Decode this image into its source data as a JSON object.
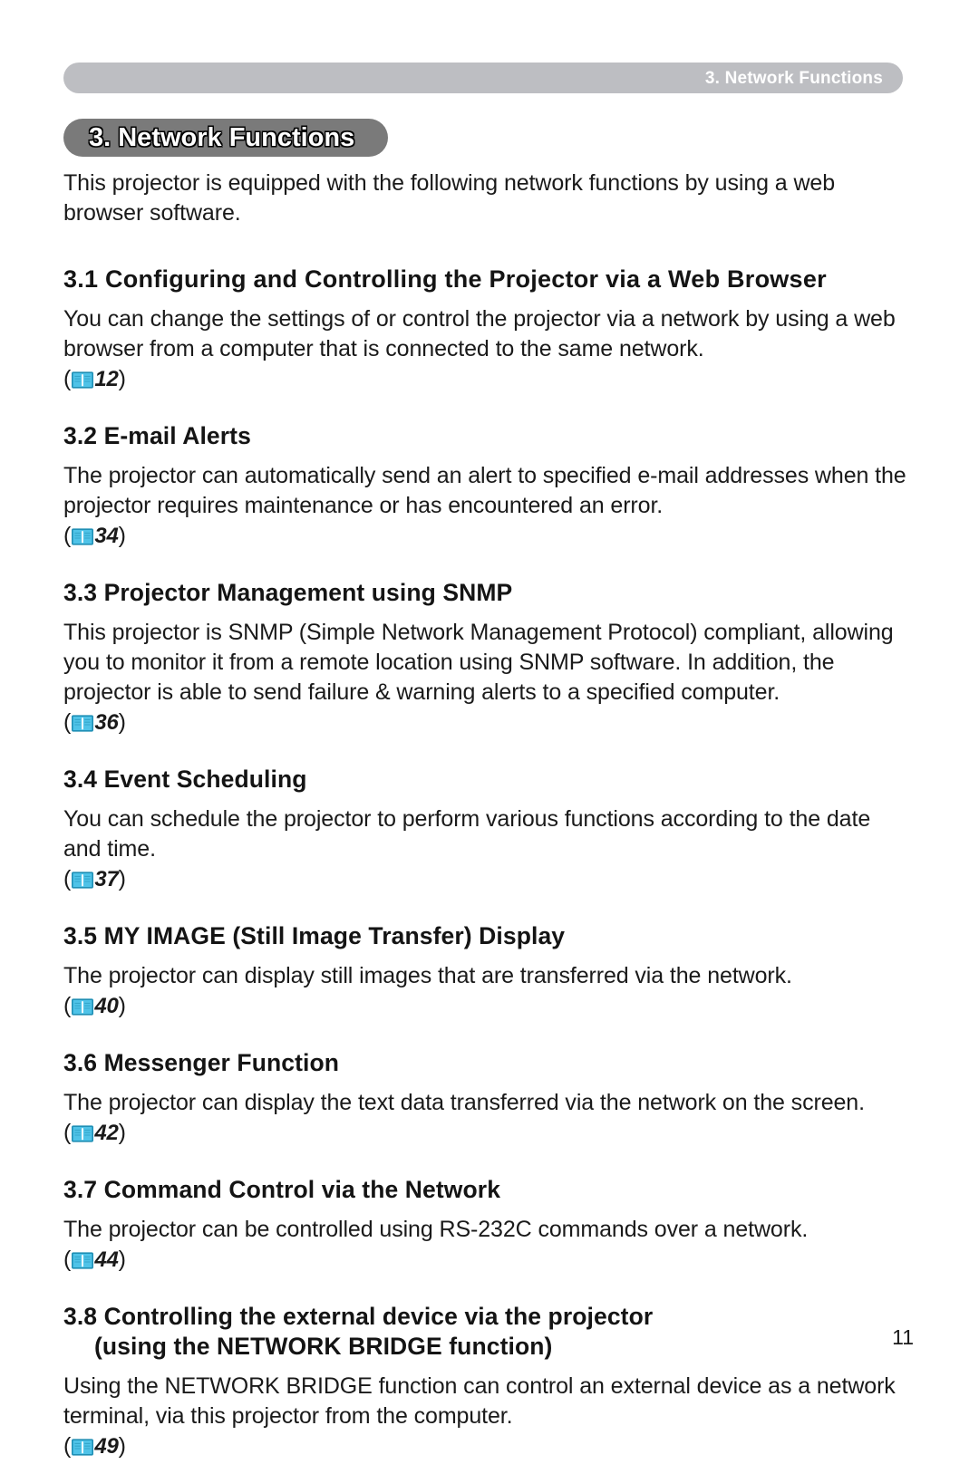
{
  "document": {
    "running_header": "3. Network Functions",
    "chapter_title": "3. Network Functions",
    "page_number": "11",
    "icon_colors": {
      "book_icon_outline": "#1f8fb5",
      "book_icon_fill": "#4fc3e8",
      "header_bar": "#bdbec2",
      "title_pill": "#7a7a7a"
    }
  },
  "intro": {
    "text": "This projector is equipped with the following network functions by using a web browser software."
  },
  "sections": [
    {
      "heading": "3.1 Configuring and Controlling the Projector via a Web Browser",
      "body": "You can change the settings of or control the projector via a network by using a web browser from a computer that is connected to the same network.",
      "ref_open": "(",
      "ref_icon": "book-icon",
      "ref_page": "12",
      "ref_close": ")"
    },
    {
      "heading": "3.2 E-mail Alerts",
      "body": "The projector can automatically send an alert to specified e-mail addresses when the projector requires maintenance or has encountered an error.",
      "ref_open": "(",
      "ref_icon": "book-icon",
      "ref_page": "34",
      "ref_close": ")"
    },
    {
      "heading": "3.3 Projector Management using SNMP",
      "body": "This projector is SNMP (Simple Network Management Protocol) compliant, allowing you to monitor it from a remote location using SNMP software. In addition, the projector is able to send failure & warning alerts to a specified computer.",
      "ref_open": "(",
      "ref_icon": "book-icon",
      "ref_page": "36",
      "ref_close": ")"
    },
    {
      "heading": "3.4 Event Scheduling",
      "body": "You can schedule the projector to perform various functions according to the date and time.",
      "ref_open": "(",
      "ref_icon": "book-icon",
      "ref_page": "37",
      "ref_close": ")"
    },
    {
      "heading": "3.5 MY IMAGE (Still Image Transfer) Display",
      "body": "The projector can display still images that are transferred via the network.",
      "ref_open": "(",
      "ref_icon": "book-icon",
      "ref_page": "40",
      "ref_close": ")"
    },
    {
      "heading": "3.6 Messenger Function",
      "body": "The projector can display the text data transferred via the network on the screen.",
      "ref_open": "(",
      "ref_icon": "book-icon",
      "ref_page": "42",
      "ref_close": ")"
    },
    {
      "heading": "3.7 Command Control via the Network",
      "body": "The projector can be controlled using RS-232C commands over a network.",
      "ref_open": "(",
      "ref_icon": "book-icon",
      "ref_page": "44",
      "ref_close": ")"
    },
    {
      "heading": "3.8 Controlling the external device via the projector",
      "heading_line2": "(using the NETWORK BRIDGE function)",
      "body": "Using the NETWORK BRIDGE function can control an external device as a network terminal, via this projector from the computer.",
      "ref_open": "(",
      "ref_icon": "book-icon",
      "ref_page": "49",
      "ref_close": ")"
    }
  ]
}
